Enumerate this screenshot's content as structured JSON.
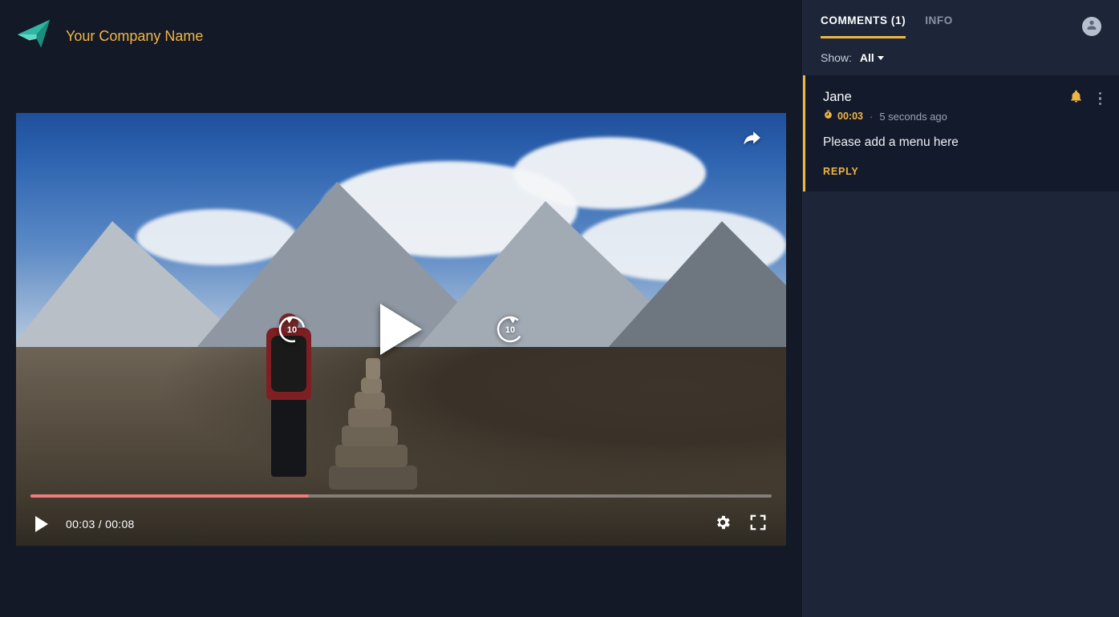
{
  "header": {
    "company_name": "Your Company Name",
    "logo_name": "paper-plane-icon"
  },
  "video": {
    "current_time": "00:03",
    "duration": "00:08",
    "time_display": "00:03 / 00:08",
    "progress_percent": 37.5,
    "skip_seconds": "10"
  },
  "sidebar": {
    "tabs": {
      "comments": "COMMENTS (1)",
      "info": "INFO"
    },
    "filter": {
      "label": "Show:",
      "value": "All"
    },
    "comment": {
      "author": "Jane",
      "timestamp": "00:03",
      "ago": "5 seconds ago",
      "separator": "·",
      "body": "Please add a menu here",
      "reply_label": "REPLY"
    }
  },
  "colors": {
    "accent": "#f0b643",
    "progress": "#f07b7b",
    "bg_main": "#141927",
    "bg_sidebar": "#1d2538",
    "bg_comment": "#131a2b"
  }
}
